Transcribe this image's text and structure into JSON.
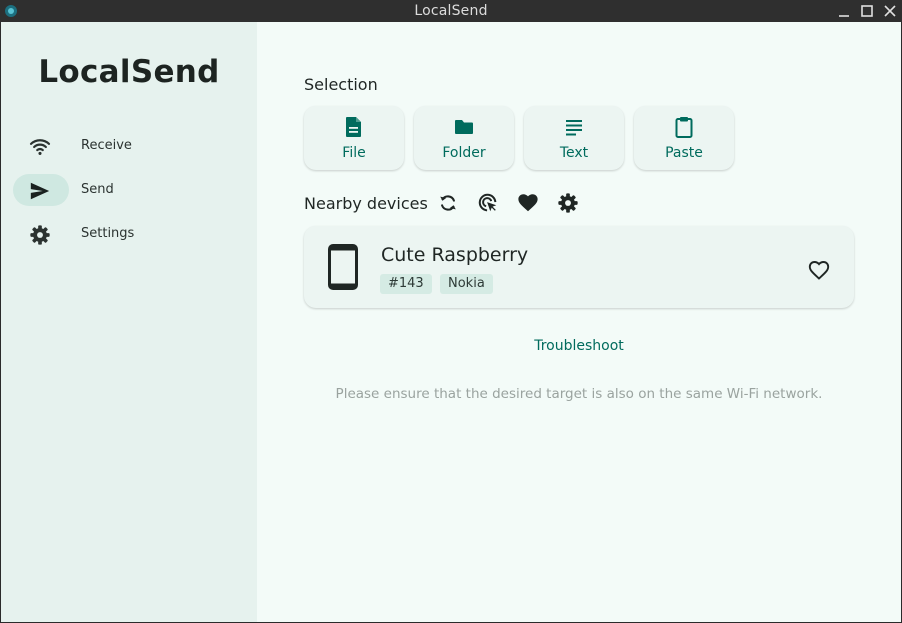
{
  "window": {
    "title": "LocalSend"
  },
  "sidebar": {
    "logo": "LocalSend",
    "items": [
      {
        "label": "Receive",
        "icon": "wifi-icon",
        "active": false
      },
      {
        "label": "Send",
        "icon": "send-icon",
        "active": true
      },
      {
        "label": "Settings",
        "icon": "gear-icon",
        "active": false
      }
    ]
  },
  "main": {
    "selection_title": "Selection",
    "selection_buttons": [
      {
        "label": "File",
        "icon": "file-icon"
      },
      {
        "label": "Folder",
        "icon": "folder-icon"
      },
      {
        "label": "Text",
        "icon": "text-icon"
      },
      {
        "label": "Paste",
        "icon": "clipboard-icon"
      }
    ],
    "nearby_title": "Nearby devices",
    "nearby_tools": [
      "refresh-icon",
      "target-icon",
      "heart-icon",
      "gear-icon"
    ],
    "device": {
      "name": "Cute Raspberry",
      "tags": [
        "#143",
        "Nokia"
      ],
      "icon": "phone-icon",
      "favorite_icon": "heart-outline-icon"
    },
    "troubleshoot": "Troubleshoot",
    "hint": "Please ensure that the desired target is also on the same Wi-Fi network."
  },
  "colors": {
    "accent": "#006b5d",
    "sidebar_bg": "#e6f2ee",
    "main_bg": "#f3fbf8",
    "card_bg": "#ecf5f2",
    "active_pill": "#cfe8e1",
    "titlebar": "#2f2f2f"
  }
}
